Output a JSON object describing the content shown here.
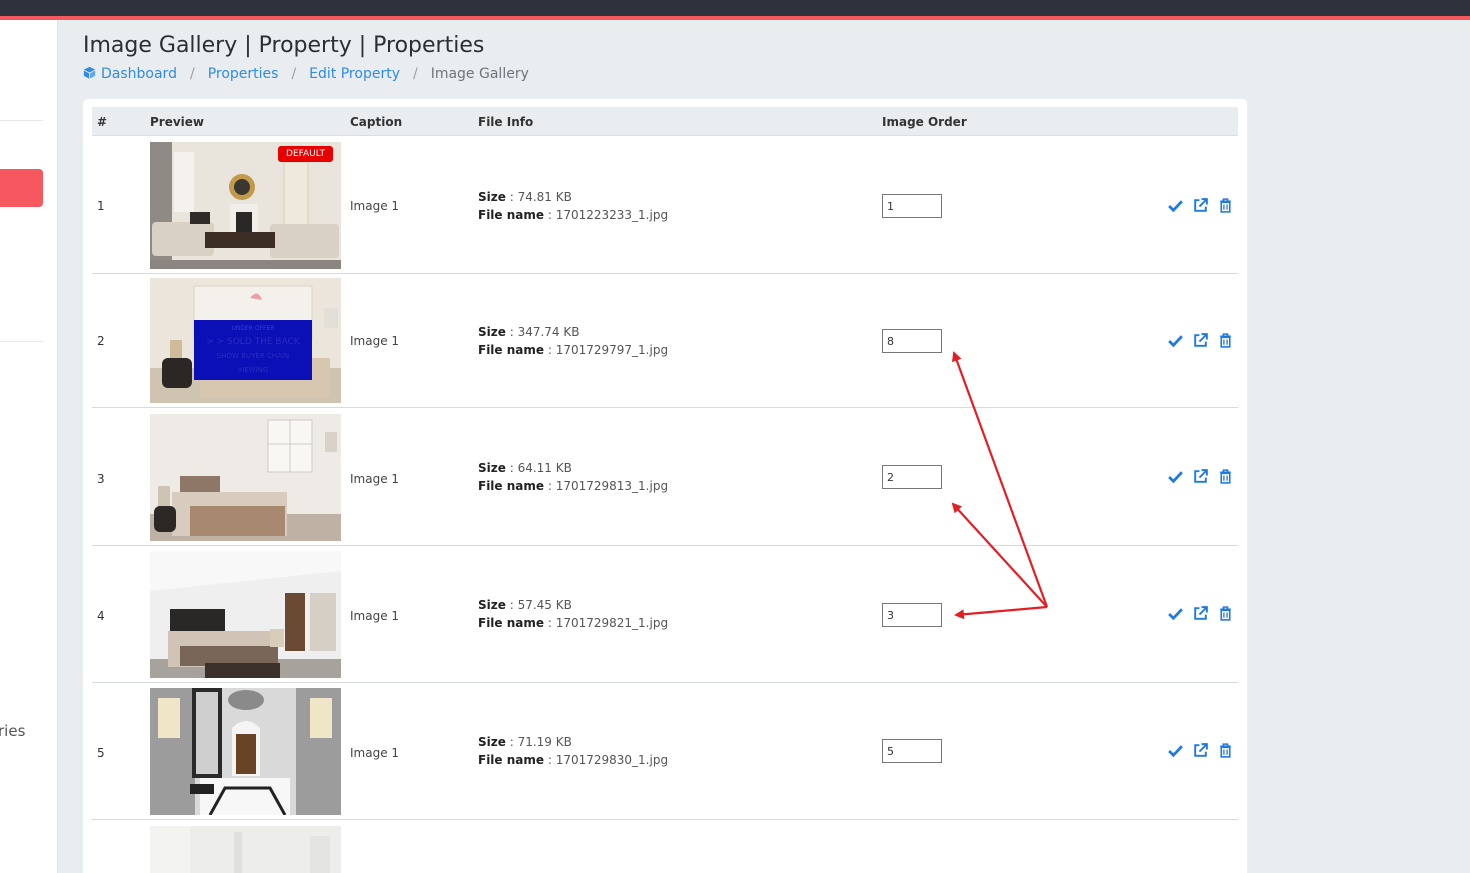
{
  "page": {
    "title": "Image Gallery | Property | Properties"
  },
  "sidebar": {
    "partial_label": "ries"
  },
  "breadcrumb": [
    {
      "label": "Dashboard"
    },
    {
      "label": "Properties"
    },
    {
      "label": "Edit Property"
    },
    {
      "label": "Image Gallery"
    }
  ],
  "table": {
    "headers": {
      "index": "#",
      "preview": "Preview",
      "caption": "Caption",
      "file_info": "File Info",
      "image_order": "Image Order"
    },
    "size_label": "Size",
    "file_name_label": "File name",
    "default_badge": "DEFAULT",
    "rows": [
      {
        "index": "1",
        "caption": "Image 1",
        "size": " : 74.81 KB",
        "file_name": " : 1701223233_1.jpg",
        "order": "1",
        "is_default": true,
        "photo": "living-room"
      },
      {
        "index": "2",
        "caption": "Image 1",
        "size": " : 347.74 KB",
        "file_name": " : 1701729797_1.jpg",
        "order": "8",
        "is_default": false,
        "photo": "bedroom-with-overlay"
      },
      {
        "index": "3",
        "caption": "Image 1",
        "size": " : 64.11 KB",
        "file_name": " : 1701729813_1.jpg",
        "order": "2",
        "is_default": false,
        "photo": "bedroom"
      },
      {
        "index": "4",
        "caption": "Image 1",
        "size": " : 57.45 KB",
        "file_name": " : 1701729821_1.jpg",
        "order": "3",
        "is_default": false,
        "photo": "bedroom"
      },
      {
        "index": "5",
        "caption": "Image 1",
        "size": " : 71.19 KB",
        "file_name": " : 1701729830_1.jpg",
        "order": "5",
        "is_default": false,
        "photo": "hallway"
      }
    ]
  },
  "actions": {
    "icons": [
      "check-icon",
      "external-link-icon",
      "trash-icon"
    ]
  },
  "colors": {
    "accent": "#f7575f",
    "link": "#2f8be6",
    "action_icon": "#1f7ae0",
    "annotation_arrow": "#e31e24",
    "top_bar": "#2d323c"
  }
}
